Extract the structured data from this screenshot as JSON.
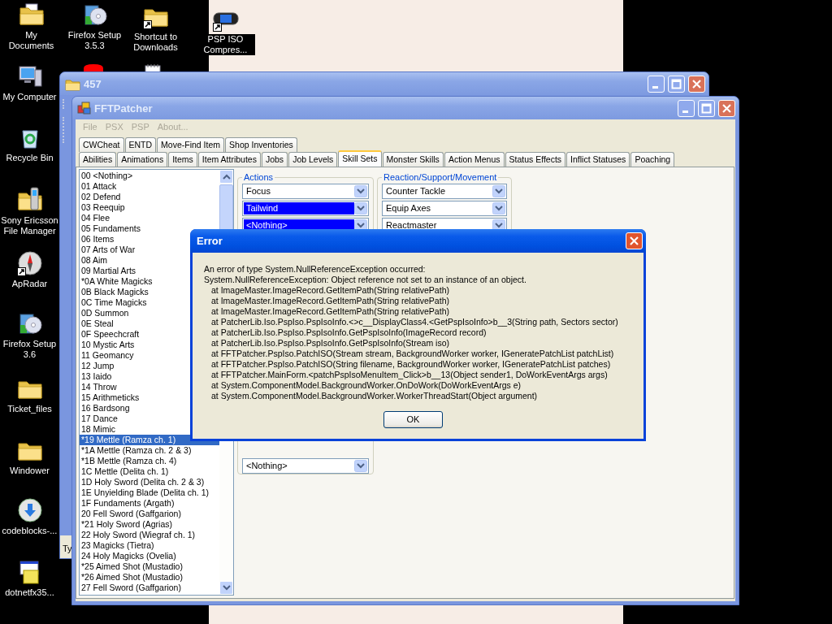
{
  "desktop_icons": [
    {
      "kind": "documents",
      "label": "My Documents",
      "shortcut": false
    },
    {
      "kind": "setup",
      "label": "Firefox Setup 3.5.3",
      "shortcut": false
    },
    {
      "kind": "folder",
      "label": "Shortcut to Downloads",
      "shortcut": true
    },
    {
      "kind": "console",
      "label": "PSP ISO Compres...",
      "shortcut": true
    },
    {
      "kind": "app"
    },
    {
      "kind": "notepad"
    },
    {
      "kind": "computer",
      "label": "My Computer",
      "shortcut": false
    },
    {
      "kind": "recycle",
      "label": "Recycle Bin",
      "shortcut": false
    },
    {
      "kind": "phone-folder",
      "label": "Sony Ericsson File Manager",
      "shortcut": false
    },
    {
      "kind": "compass",
      "label": "ApRadar",
      "shortcut": true
    },
    {
      "kind": "setup",
      "label": "Firefox Setup 3.6",
      "shortcut": false
    },
    {
      "kind": "folder",
      "label": "Ticket_files",
      "shortcut": false
    },
    {
      "kind": "folder",
      "label": "Windower",
      "shortcut": false
    },
    {
      "kind": "disc",
      "label": "codeblocks-...",
      "shortcut": false
    },
    {
      "kind": "installer",
      "label": "dotnetfx35...",
      "shortcut": false
    }
  ],
  "background_window": {
    "title": "457",
    "status_text": "Ty"
  },
  "main_window": {
    "title": "FFTPatcher",
    "menu": [
      {
        "label": "File",
        "disabled": true
      },
      {
        "label": "PSX",
        "disabled": true
      },
      {
        "label": "PSP",
        "disabled": true
      },
      {
        "label": "About...",
        "disabled": true
      }
    ],
    "tab_rows": [
      [
        {
          "label": "CWCheat",
          "selected": false
        },
        {
          "label": "ENTD",
          "selected": false
        },
        {
          "label": "Move-Find Item",
          "selected": false
        },
        {
          "label": "Shop Inventories",
          "selected": false
        }
      ],
      [
        {
          "label": "Abilities",
          "selected": false
        },
        {
          "label": "Animations",
          "selected": false
        },
        {
          "label": "Items",
          "selected": false
        },
        {
          "label": "Item Attributes",
          "selected": false
        },
        {
          "label": "Jobs",
          "selected": false
        },
        {
          "label": "Job Levels",
          "selected": false
        },
        {
          "label": "Skill Sets",
          "selected": true
        },
        {
          "label": "Monster Skills",
          "selected": false
        },
        {
          "label": "Action Menus",
          "selected": false
        },
        {
          "label": "Status Effects",
          "selected": false
        },
        {
          "label": "Inflict Statuses",
          "selected": false
        },
        {
          "label": "Poaching",
          "selected": false
        }
      ]
    ],
    "skill_list": [
      {
        "label": "00 <Nothing>",
        "selected": false
      },
      {
        "label": "01 Attack",
        "selected": false
      },
      {
        "label": "02 Defend",
        "selected": false
      },
      {
        "label": "03 Reequip",
        "selected": false
      },
      {
        "label": "04 Flee",
        "selected": false
      },
      {
        "label": "05 Fundaments",
        "selected": false
      },
      {
        "label": "06 Items",
        "selected": false
      },
      {
        "label": "07 Arts of War",
        "selected": false
      },
      {
        "label": "08 Aim",
        "selected": false
      },
      {
        "label": "09 Martial Arts",
        "selected": false
      },
      {
        "label": "*0A White Magicks",
        "selected": false
      },
      {
        "label": "0B Black Magicks",
        "selected": false
      },
      {
        "label": "0C Time Magicks",
        "selected": false
      },
      {
        "label": "0D Summon",
        "selected": false
      },
      {
        "label": "0E Steal",
        "selected": false
      },
      {
        "label": "0F Speechcraft",
        "selected": false
      },
      {
        "label": "10 Mystic Arts",
        "selected": false
      },
      {
        "label": "11 Geomancy",
        "selected": false
      },
      {
        "label": "12 Jump",
        "selected": false
      },
      {
        "label": "13 Iaido",
        "selected": false
      },
      {
        "label": "14 Throw",
        "selected": false
      },
      {
        "label": "15 Arithmeticks",
        "selected": false
      },
      {
        "label": "16 Bardsong",
        "selected": false
      },
      {
        "label": "17 Dance",
        "selected": false
      },
      {
        "label": "18 Mimic",
        "selected": false
      },
      {
        "label": "*19 Mettle (Ramza ch. 1)",
        "selected": true
      },
      {
        "label": "*1A Mettle (Ramza ch. 2 & 3)",
        "selected": false
      },
      {
        "label": "*1B Mettle (Ramza ch. 4)",
        "selected": false
      },
      {
        "label": "1C Mettle (Delita ch. 1)",
        "selected": false
      },
      {
        "label": "1D Holy Sword (Delita ch. 2 & 3)",
        "selected": false
      },
      {
        "label": "1E Unyielding Blade (Delita ch. 1)",
        "selected": false
      },
      {
        "label": "1F Fundaments (Argath)",
        "selected": false
      },
      {
        "label": "20 Fell Sword (Gaffgarion)",
        "selected": false
      },
      {
        "label": "*21 Holy Sword (Agrias)",
        "selected": false
      },
      {
        "label": "22 Holy Sword (Wiegraf ch. 1)",
        "selected": false
      },
      {
        "label": "23 Magicks (Tietra)",
        "selected": false
      },
      {
        "label": "24 Holy Magicks (Ovelia)",
        "selected": false
      },
      {
        "label": "*25 Aimed Shot (Mustadio)",
        "selected": false
      },
      {
        "label": "*26 Aimed Shot (Mustadio)",
        "selected": false
      },
      {
        "label": "27 Fell Sword (Gaffgarion)",
        "selected": false
      }
    ],
    "groups": [
      {
        "title": "Actions",
        "dropdowns": [
          {
            "value": "Focus",
            "highlighted": false
          },
          {
            "value": "Tailwind",
            "highlighted": true
          },
          {
            "value": "<Nothing>",
            "highlighted": true
          },
          {
            "value": "<Nothing>",
            "highlighted": false
          }
        ]
      },
      {
        "title": "Reaction/Support/Movement",
        "dropdowns": [
          {
            "value": "Counter Tackle",
            "highlighted": false
          },
          {
            "value": "Equip Axes",
            "highlighted": false
          },
          {
            "value": "Reactmaster",
            "highlighted": false
          }
        ]
      }
    ]
  },
  "dialog": {
    "title": "Error",
    "lines": [
      {
        "text": "An error of type System.NullReferenceException occurred:",
        "indent": false
      },
      {
        "text": "System.NullReferenceException: Object reference not set to an instance of an object.",
        "indent": false
      },
      {
        "text": "at ImageMaster.ImageRecord.GetItemPath(String relativePath)",
        "indent": true
      },
      {
        "text": "at ImageMaster.ImageRecord.GetItemPath(String relativePath)",
        "indent": true
      },
      {
        "text": "at ImageMaster.ImageRecord.GetItemPath(String relativePath)",
        "indent": true
      },
      {
        "text": "at PatcherLib.Iso.PspIso.PspIsoInfo.<>c__DisplayClass4.<GetPspIsoInfo>b__3(String path, Sectors sector)",
        "indent": true
      },
      {
        "text": "at PatcherLib.Iso.PspIso.PspIsoInfo.GetPspIsoInfo(ImageRecord record)",
        "indent": true
      },
      {
        "text": "at PatcherLib.Iso.PspIso.PspIsoInfo.GetPspIsoInfo(Stream iso)",
        "indent": true
      },
      {
        "text": "at FFTPatcher.PspIso.PatchISO(Stream stream, BackgroundWorker worker, IGeneratePatchList patchList)",
        "indent": true
      },
      {
        "text": "at FFTPatcher.PspIso.PatchISO(String filename, BackgroundWorker worker, IGeneratePatchList patches)",
        "indent": true
      },
      {
        "text": "at FFTPatcher.MainForm.<patchPspIsoMenuItem_Click>b__13(Object sender1, DoWorkEventArgs args)",
        "indent": true
      },
      {
        "text": "at System.ComponentModel.BackgroundWorker.OnDoWork(DoWorkEventArgs e)",
        "indent": true
      },
      {
        "text": "at System.ComponentModel.BackgroundWorker.WorkerThreadStart(Object argument)",
        "indent": true
      }
    ],
    "button": "OK"
  }
}
